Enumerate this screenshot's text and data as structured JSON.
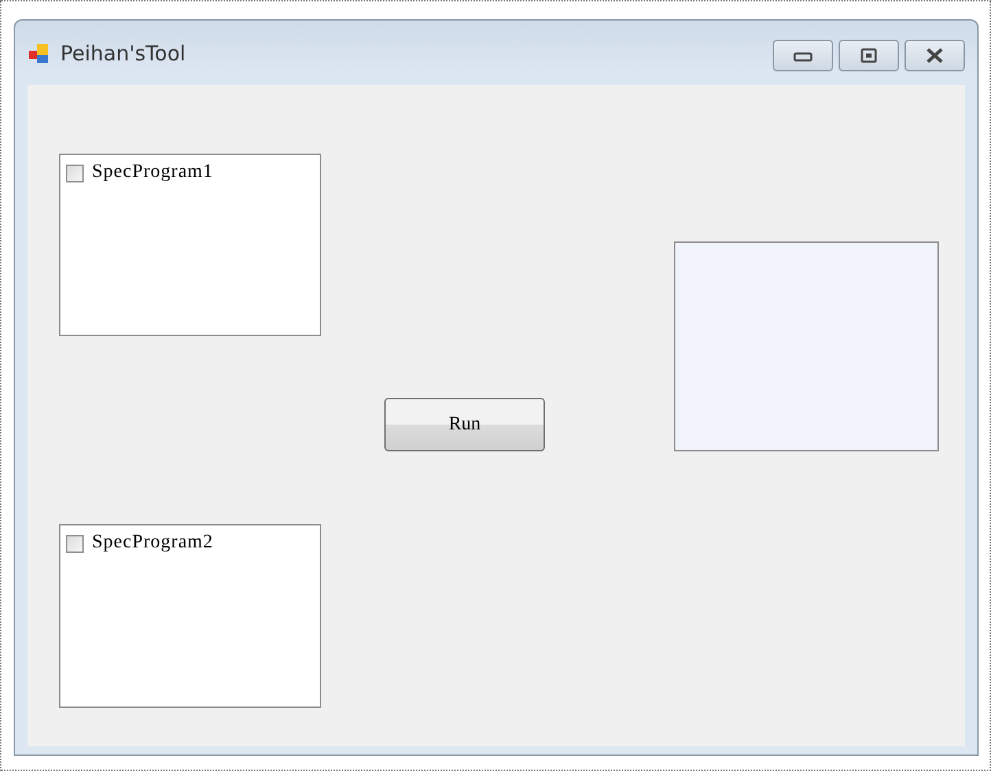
{
  "window": {
    "title": "Peihan'sTool"
  },
  "checked_lists": [
    {
      "items": [
        {
          "label": "SpecProgram1",
          "checked": false
        }
      ]
    },
    {
      "items": [
        {
          "label": "SpecProgram2",
          "checked": false
        }
      ]
    }
  ],
  "buttons": [
    {
      "label": "Run"
    }
  ]
}
